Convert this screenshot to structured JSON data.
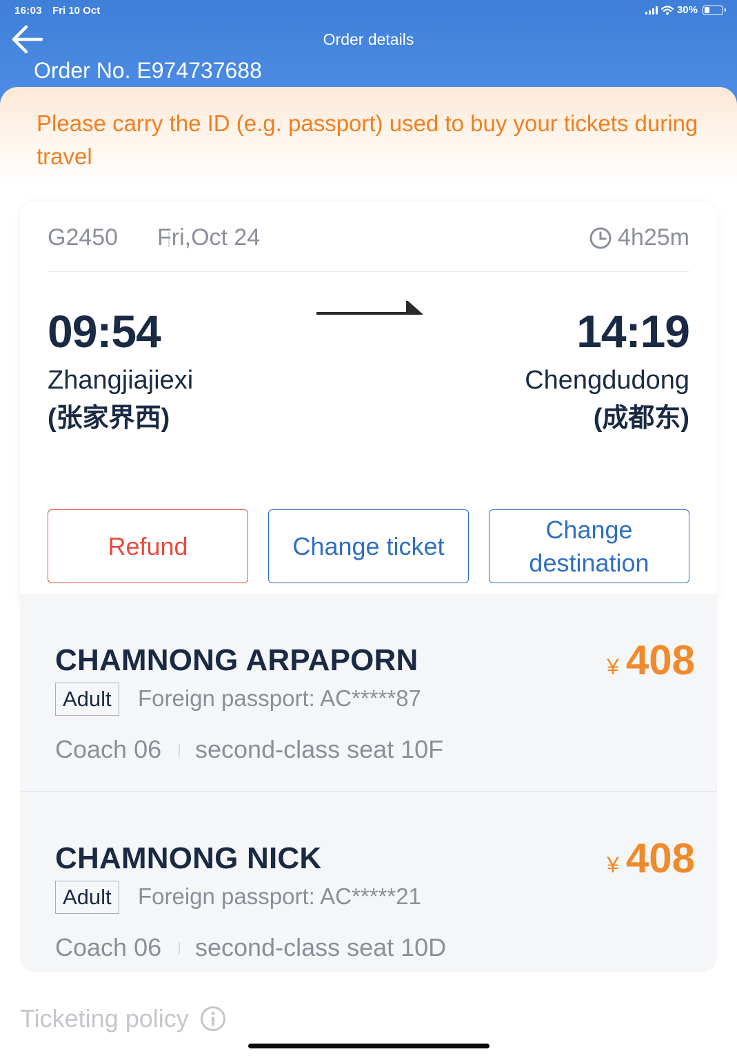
{
  "status_bar": {
    "time": "16:03",
    "date": "Fri 10 Oct",
    "battery": "30%",
    "battery_level": 0.3
  },
  "header": {
    "title": "Order details",
    "order_no": "Order No. E974737688"
  },
  "notice": "Please carry the ID (e.g. passport) used to buy your tickets during travel",
  "trip": {
    "train_no": "G2450",
    "date": "Fri,Oct 24",
    "duration": "4h25m",
    "departure": {
      "time": "09:54",
      "station": "Zhangjiajiexi",
      "station_cn": "(张家界西)"
    },
    "arrival": {
      "time": "14:19",
      "station": "Chengdudong",
      "station_cn": "(成都东)"
    },
    "buttons": {
      "refund": "Refund",
      "change_ticket": "Change ticket",
      "change_destination": "Change destination"
    }
  },
  "passengers": [
    {
      "name": "CHAMNONG ARPAPORN",
      "type": "Adult",
      "passport": "Foreign passport: AC*****87",
      "coach": "Coach 06",
      "seat": "second-class seat 10F",
      "currency": "¥",
      "price": "408"
    },
    {
      "name": "CHAMNONG NICK",
      "type": "Adult",
      "passport": "Foreign passport: AC*****21",
      "coach": "Coach 06",
      "seat": "second-class seat 10D",
      "currency": "¥",
      "price": "408"
    }
  ],
  "policy": "Ticketing policy",
  "colors": {
    "header_blue": "#4a88e0",
    "notice_orange": "#f07f20",
    "refund_red": "#ea4b3c",
    "action_blue": "#2e6fc4",
    "price_orange": "#f08a2a"
  }
}
